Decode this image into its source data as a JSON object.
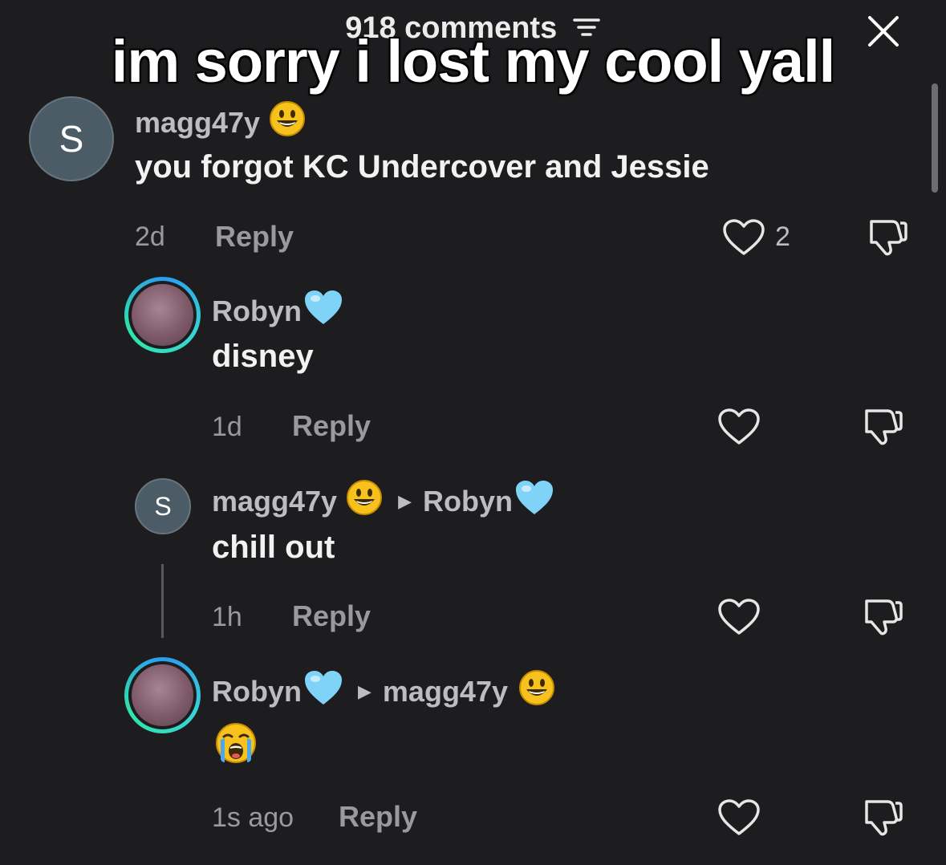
{
  "header": {
    "comment_count": "918 comments"
  },
  "caption": "im sorry i lost my cool yall",
  "comments": [
    {
      "avatar_letter": "S",
      "username": "magg47y",
      "reply_to": "",
      "text": "you forgot KC Undercover and Jessie",
      "time": "2d",
      "reply_label": "Reply",
      "likes": "2"
    },
    {
      "username": "Robyn",
      "reply_to": "",
      "text": "disney",
      "time": "1d",
      "reply_label": "Reply",
      "likes": ""
    },
    {
      "avatar_letter": "S",
      "username": "magg47y",
      "reply_to": "Robyn",
      "text": "chill out",
      "time": "1h",
      "reply_label": "Reply",
      "likes": ""
    },
    {
      "username": "Robyn",
      "reply_to": "magg47y",
      "text": "",
      "time": "1s ago",
      "reply_label": "Reply",
      "likes": ""
    }
  ],
  "icons": {
    "close": "close-icon",
    "filter": "filter-icon",
    "like": "heart-outline-icon",
    "dislike": "thumbs-down-icon",
    "emoji_smile": "grinning-face-emoji",
    "emoji_heart": "light-blue-heart-emoji",
    "emoji_cry": "loudly-crying-face-emoji"
  },
  "colors": {
    "background": "#1d1d1f",
    "avatar_ring": "#39d3d6"
  }
}
